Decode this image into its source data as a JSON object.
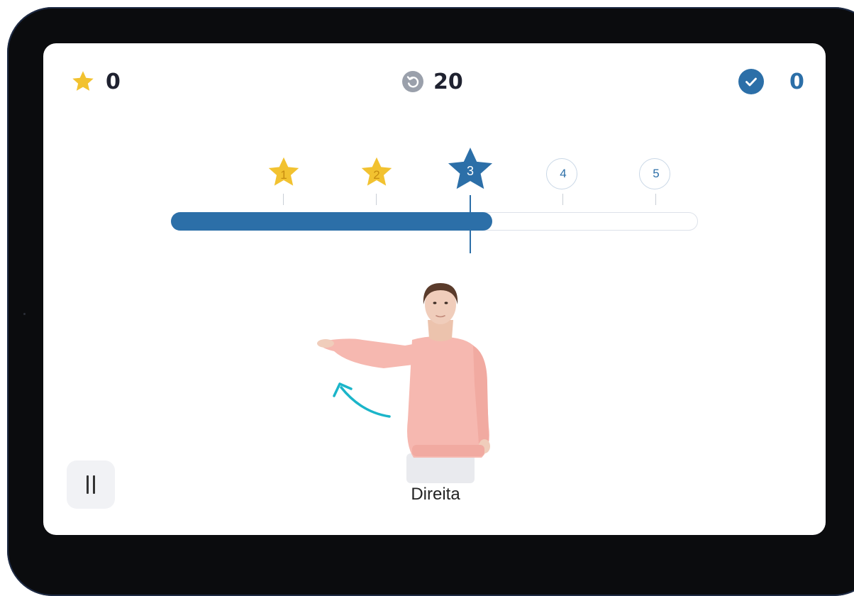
{
  "hud": {
    "stars_count": "0",
    "moves_remaining": "20",
    "correct_count": "0"
  },
  "progress": {
    "milestones": [
      {
        "label": "1",
        "state": "earned"
      },
      {
        "label": "2",
        "state": "earned"
      },
      {
        "label": "3",
        "state": "active"
      },
      {
        "label": "4",
        "state": "pending"
      },
      {
        "label": "5",
        "state": "pending"
      }
    ],
    "fill_fraction": 0.61
  },
  "exercise": {
    "caption": "Direita"
  },
  "controls": {
    "pause_icon": "pause-icon"
  },
  "colors": {
    "accent_blue": "#2c6fa8",
    "star_gold": "#f2c230",
    "timer_gray": "#9aa0ab",
    "arrow_teal": "#1bb5c9",
    "sweater_pink": "#f6b8b0"
  }
}
